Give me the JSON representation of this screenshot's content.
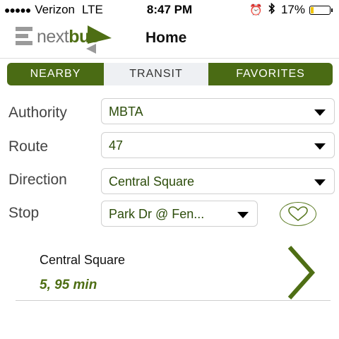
{
  "status_bar": {
    "carrier": "Verizon",
    "network": "LTE",
    "time": "8:47 PM",
    "battery": "17%",
    "battery_level": 0.17
  },
  "nav": {
    "logo_next": "next",
    "logo_bus": "bus",
    "title": "Home"
  },
  "tabs": [
    {
      "label": "NEARBY"
    },
    {
      "label": "TRANSIT",
      "selected": true
    },
    {
      "label": "FAVORITES"
    }
  ],
  "form": {
    "authority": {
      "label": "Authority",
      "value": "MBTA"
    },
    "route": {
      "label": "Route",
      "value": "47"
    },
    "direction": {
      "label": "Direction",
      "value": "Central Square"
    },
    "stop": {
      "label": "Stop",
      "value": "Park Dr @ Fen..."
    }
  },
  "prediction": {
    "destination": "Central Square",
    "times": "5, 95 min"
  },
  "colors": {
    "brand_green": "#4a6b14",
    "text_green": "#2d4d0b",
    "selected_tab_bg": "#eef0f3"
  },
  "icons": [
    "alarm-icon",
    "bluetooth-icon",
    "battery-icon",
    "dropdown-caret-icon",
    "heart-icon",
    "chevron-right-icon"
  ]
}
